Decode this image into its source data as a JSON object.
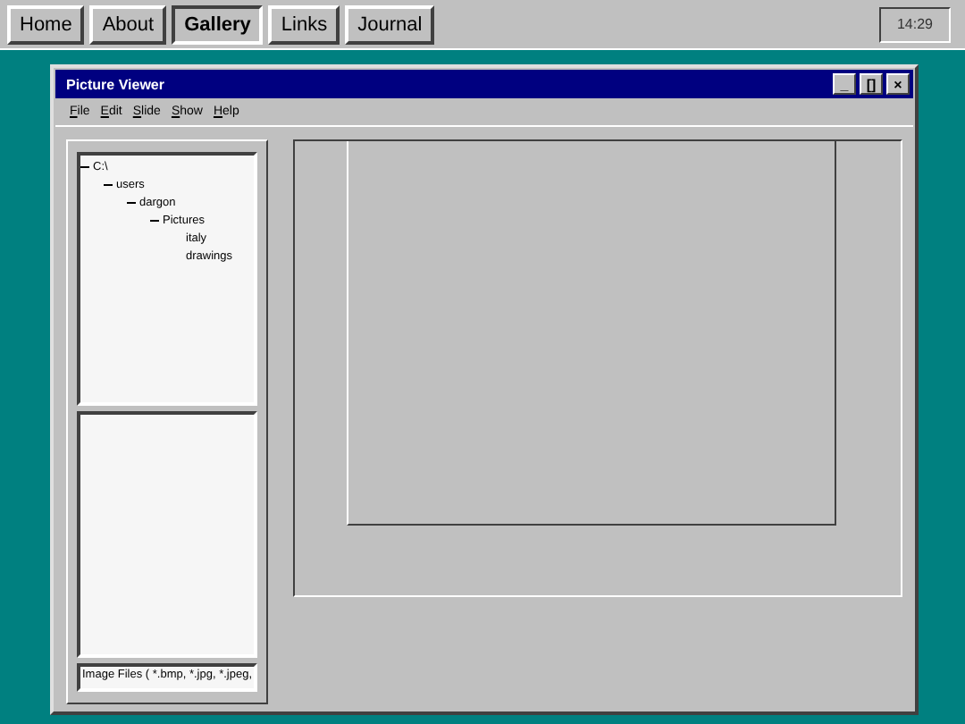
{
  "nav": [
    {
      "label": "Home",
      "selected": false
    },
    {
      "label": "About",
      "selected": false
    },
    {
      "label": "Gallery",
      "selected": true
    },
    {
      "label": "Links",
      "selected": false
    },
    {
      "label": "Journal",
      "selected": false
    }
  ],
  "clock": "14:29",
  "window": {
    "title": "Picture Viewer",
    "buttons": [
      "_",
      "[]",
      "×"
    ]
  },
  "menu": [
    "File",
    "Edit",
    "Slide",
    "Show",
    "Help"
  ],
  "tree": [
    {
      "label": "C:\\",
      "expanded": true,
      "children": [
        {
          "label": "users",
          "expanded": true,
          "children": [
            {
              "label": "dargon",
              "expanded": true,
              "children": [
                {
                  "label": "Pictures",
                  "expanded": true,
                  "children": [
                    {
                      "label": "italy",
                      "expanded": false
                    },
                    {
                      "label": "drawings",
                      "expanded": false
                    }
                  ]
                }
              ]
            }
          ]
        }
      ]
    }
  ],
  "filter": "Image Files ( *.bmp, *.jpg, *.jpeg,"
}
